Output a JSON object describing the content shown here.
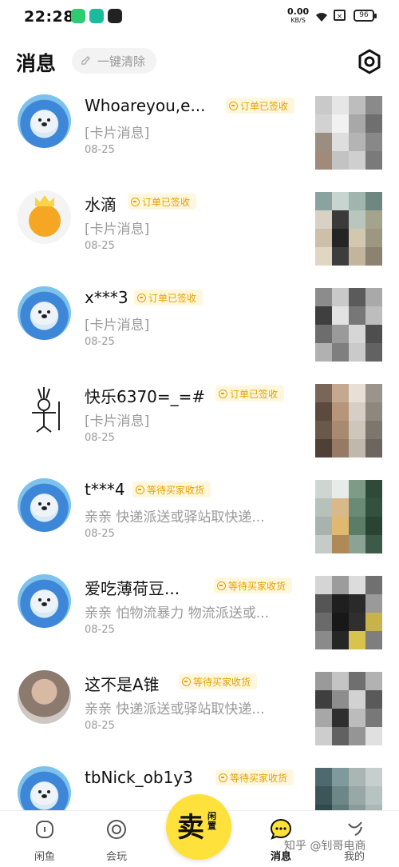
{
  "status_bar": {
    "time": "22:28",
    "net_speed": "0.00",
    "net_unit": "KB/S",
    "battery": "96"
  },
  "header": {
    "title": "消息",
    "clear_all": "一键清除"
  },
  "messages": [
    {
      "name": "Whoareyou,e...",
      "badge": "订单已签收",
      "preview": "[卡片消息]",
      "date": "08-25",
      "avatar": "seal-avatar"
    },
    {
      "name": "水滴",
      "badge": "订单已签收",
      "preview": "[卡片消息]",
      "date": "08-25",
      "avatar": "orange-avatar"
    },
    {
      "name": "x***3",
      "badge": "订单已签收",
      "preview": "[卡片消息]",
      "date": "08-25",
      "avatar": "seal-avatar"
    },
    {
      "name": "快乐6370=_=#",
      "badge": "订单已签收",
      "preview": "[卡片消息]",
      "date": "08-25",
      "avatar": "sketch-avatar"
    },
    {
      "name": "t***4",
      "badge": "等待买家收货",
      "preview": "亲亲 快递派送或驿站取快递...",
      "date": "08-25",
      "avatar": "seal-avatar"
    },
    {
      "name": "爱吃薄荷豆...",
      "badge": "等待买家收货",
      "preview": "亲亲 怕物流暴力 物流派送或...",
      "date": "08-25",
      "avatar": "seal-avatar"
    },
    {
      "name": "这不是A锥",
      "badge": "等待买家收货",
      "preview": "亲亲 快递派送或驿站取快递...",
      "date": "08-25",
      "avatar": "photo-avatar"
    },
    {
      "name": "tbNick_ob1y3",
      "badge": "等待买家收货",
      "preview": "",
      "date": "",
      "avatar": "seal-avatar"
    }
  ],
  "tab_bar": {
    "home": "闲鱼",
    "play": "会玩",
    "sell_main": "卖",
    "sell_sub": "闲置",
    "messages": "消息",
    "me": "我的"
  },
  "watermark": "知乎 @钊哥电商",
  "colors": {
    "accent": "#ffe13b",
    "badge_text": "#e5a000",
    "badge_bg": "#fff7dd"
  }
}
